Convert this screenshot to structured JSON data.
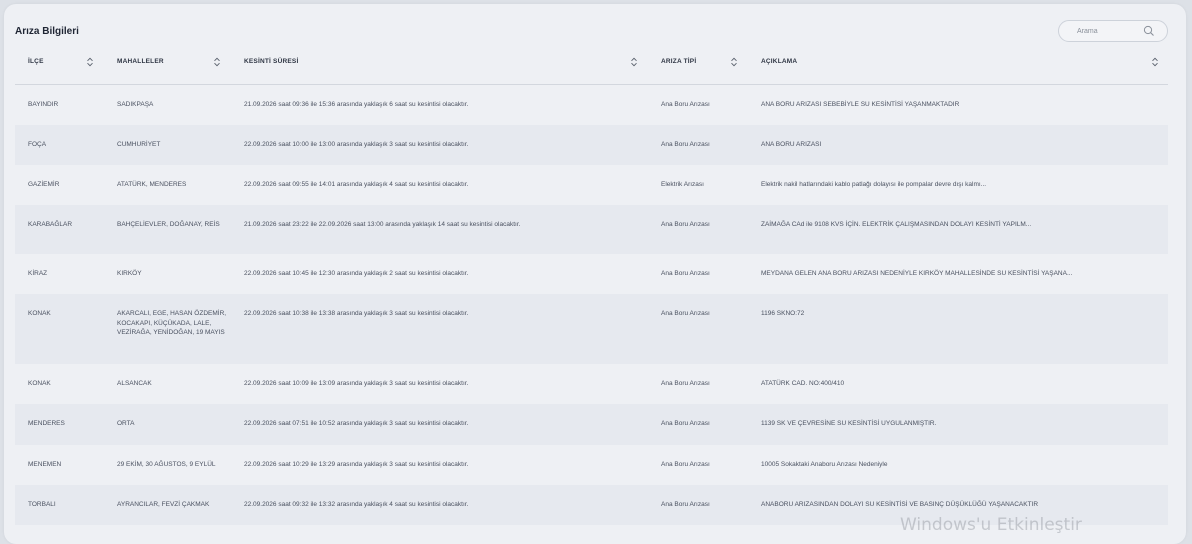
{
  "panel": {
    "title": "Arıza Bilgileri"
  },
  "search": {
    "placeholder": "Arama"
  },
  "columns": [
    "İLÇE",
    "MAHALLELER",
    "KESİNTİ SÜRESİ",
    "ARIZA TİPİ",
    "AÇIKLAMA"
  ],
  "rows": [
    {
      "ilce": "BAYINDIR",
      "mahalle": "SADIKPAŞA",
      "sure": "21.09.2026 saat 09:36 ile 15:36 arasında yaklaşık 6 saat su kesintisi olacaktır.",
      "tip": "Ana Boru Arızası",
      "aciklama": "ANA BORU ARIZASI SEBEBİYLE SU KESİNTİSİ YAŞANMAKTADIR"
    },
    {
      "ilce": "FOÇA",
      "mahalle": "CUMHURİYET",
      "sure": "22.09.2026 saat 10:00 ile 13:00 arasında yaklaşık 3 saat su kesintisi olacaktır.",
      "tip": "Ana Boru Arızası",
      "aciklama": "ANA BORU ARIZASI"
    },
    {
      "ilce": "GAZİEMİR",
      "mahalle": "ATATÜRK, MENDERES",
      "sure": "22.09.2026 saat 09:55 ile 14:01 arasında yaklaşık 4 saat su kesintisi olacaktır.",
      "tip": "Elektrik Arızası",
      "aciklama": "Elektrik nakil hatlarındaki kablo patlağı dolayısı ile pompalar devre dışı kalmı..."
    },
    {
      "ilce": "KARABAĞLAR",
      "mahalle": "BAHÇELİEVLER, DOĞANAY, REİS",
      "sure": "21.09.2026 saat 23:22 ile 22.09.2026 saat 13:00 arasında yaklaşık 14 saat su kesintisi olacaktır.",
      "tip": "Ana Boru Arızası",
      "aciklama": "ZAİMAĞA CAd ile 9108 KVS İÇİN. ELEKTRİK ÇALIŞMASINDAN DOLAYI KESİNTİ YAPILM..."
    },
    {
      "ilce": "KİRAZ",
      "mahalle": "KIRKÖY",
      "sure": "22.09.2026 saat 10:45 ile 12:30 arasında yaklaşık 2 saat su kesintisi olacaktır.",
      "tip": "Ana Boru Arızası",
      "aciklama": "MEYDANA GELEN ANA BORU ARIZASI NEDENİYLE KIRKÖY MAHALLESİNDE SU KESİNTİSİ YAŞANA..."
    },
    {
      "ilce": "KONAK",
      "mahalle": "AKARCALI, EGE, HASAN ÖZDEMİR, KOCAKAPI, KÜÇÜKADA, LALE, VEZİRAĞA, YENİDOĞAN, 19 MAYIS",
      "sure": "22.09.2026 saat 10:38 ile 13:38 arasında yaklaşık 3 saat su kesintisi olacaktır.",
      "tip": "Ana Boru Arızası",
      "aciklama": "1196 SKNO:72"
    },
    {
      "ilce": "KONAK",
      "mahalle": "ALSANCAK",
      "sure": "22.09.2026 saat 10:09 ile 13:09 arasında yaklaşık 3 saat su kesintisi olacaktır.",
      "tip": "Ana Boru Arızası",
      "aciklama": "ATATÜRK CAD. NO:400/410"
    },
    {
      "ilce": "MENDERES",
      "mahalle": "ORTA",
      "sure": "22.09.2026 saat 07:51 ile 10:52 arasında yaklaşık 3 saat su kesintisi olacaktır.",
      "tip": "Ana Boru Arızası",
      "aciklama": "1139 SK VE ÇEVRESİNE SU KESİNTİSİ UYGULANMIŞTIR."
    },
    {
      "ilce": "MENEMEN",
      "mahalle": "29 EKİM, 30 AĞUSTOS, 9 EYLÜL",
      "sure": "22.09.2026 saat 10:29 ile 13:29 arasında yaklaşık 3 saat su kesintisi olacaktır.",
      "tip": "Ana Boru Arızası",
      "aciklama": "10005 Sokaktaki Anaboru Arızası Nedeniyle"
    },
    {
      "ilce": "TORBALI",
      "mahalle": "AYRANCILAR, FEVZİ ÇAKMAK",
      "sure": "22.09.2026 saat 09:32 ile 13:32 arasında yaklaşık 4 saat su kesintisi olacaktır.",
      "tip": "Ana Boru Arızası",
      "aciklama": "ANABORU ARIZASINDAN DOLAYI SU KESİNTİSİ VE BASINÇ DÜŞÜKLÜĞÜ YAŞANACAKTIR"
    }
  ],
  "watermark": "Windows'u Etkinleştir",
  "icons": {
    "search": "search-icon",
    "sort": "sort-icon"
  }
}
